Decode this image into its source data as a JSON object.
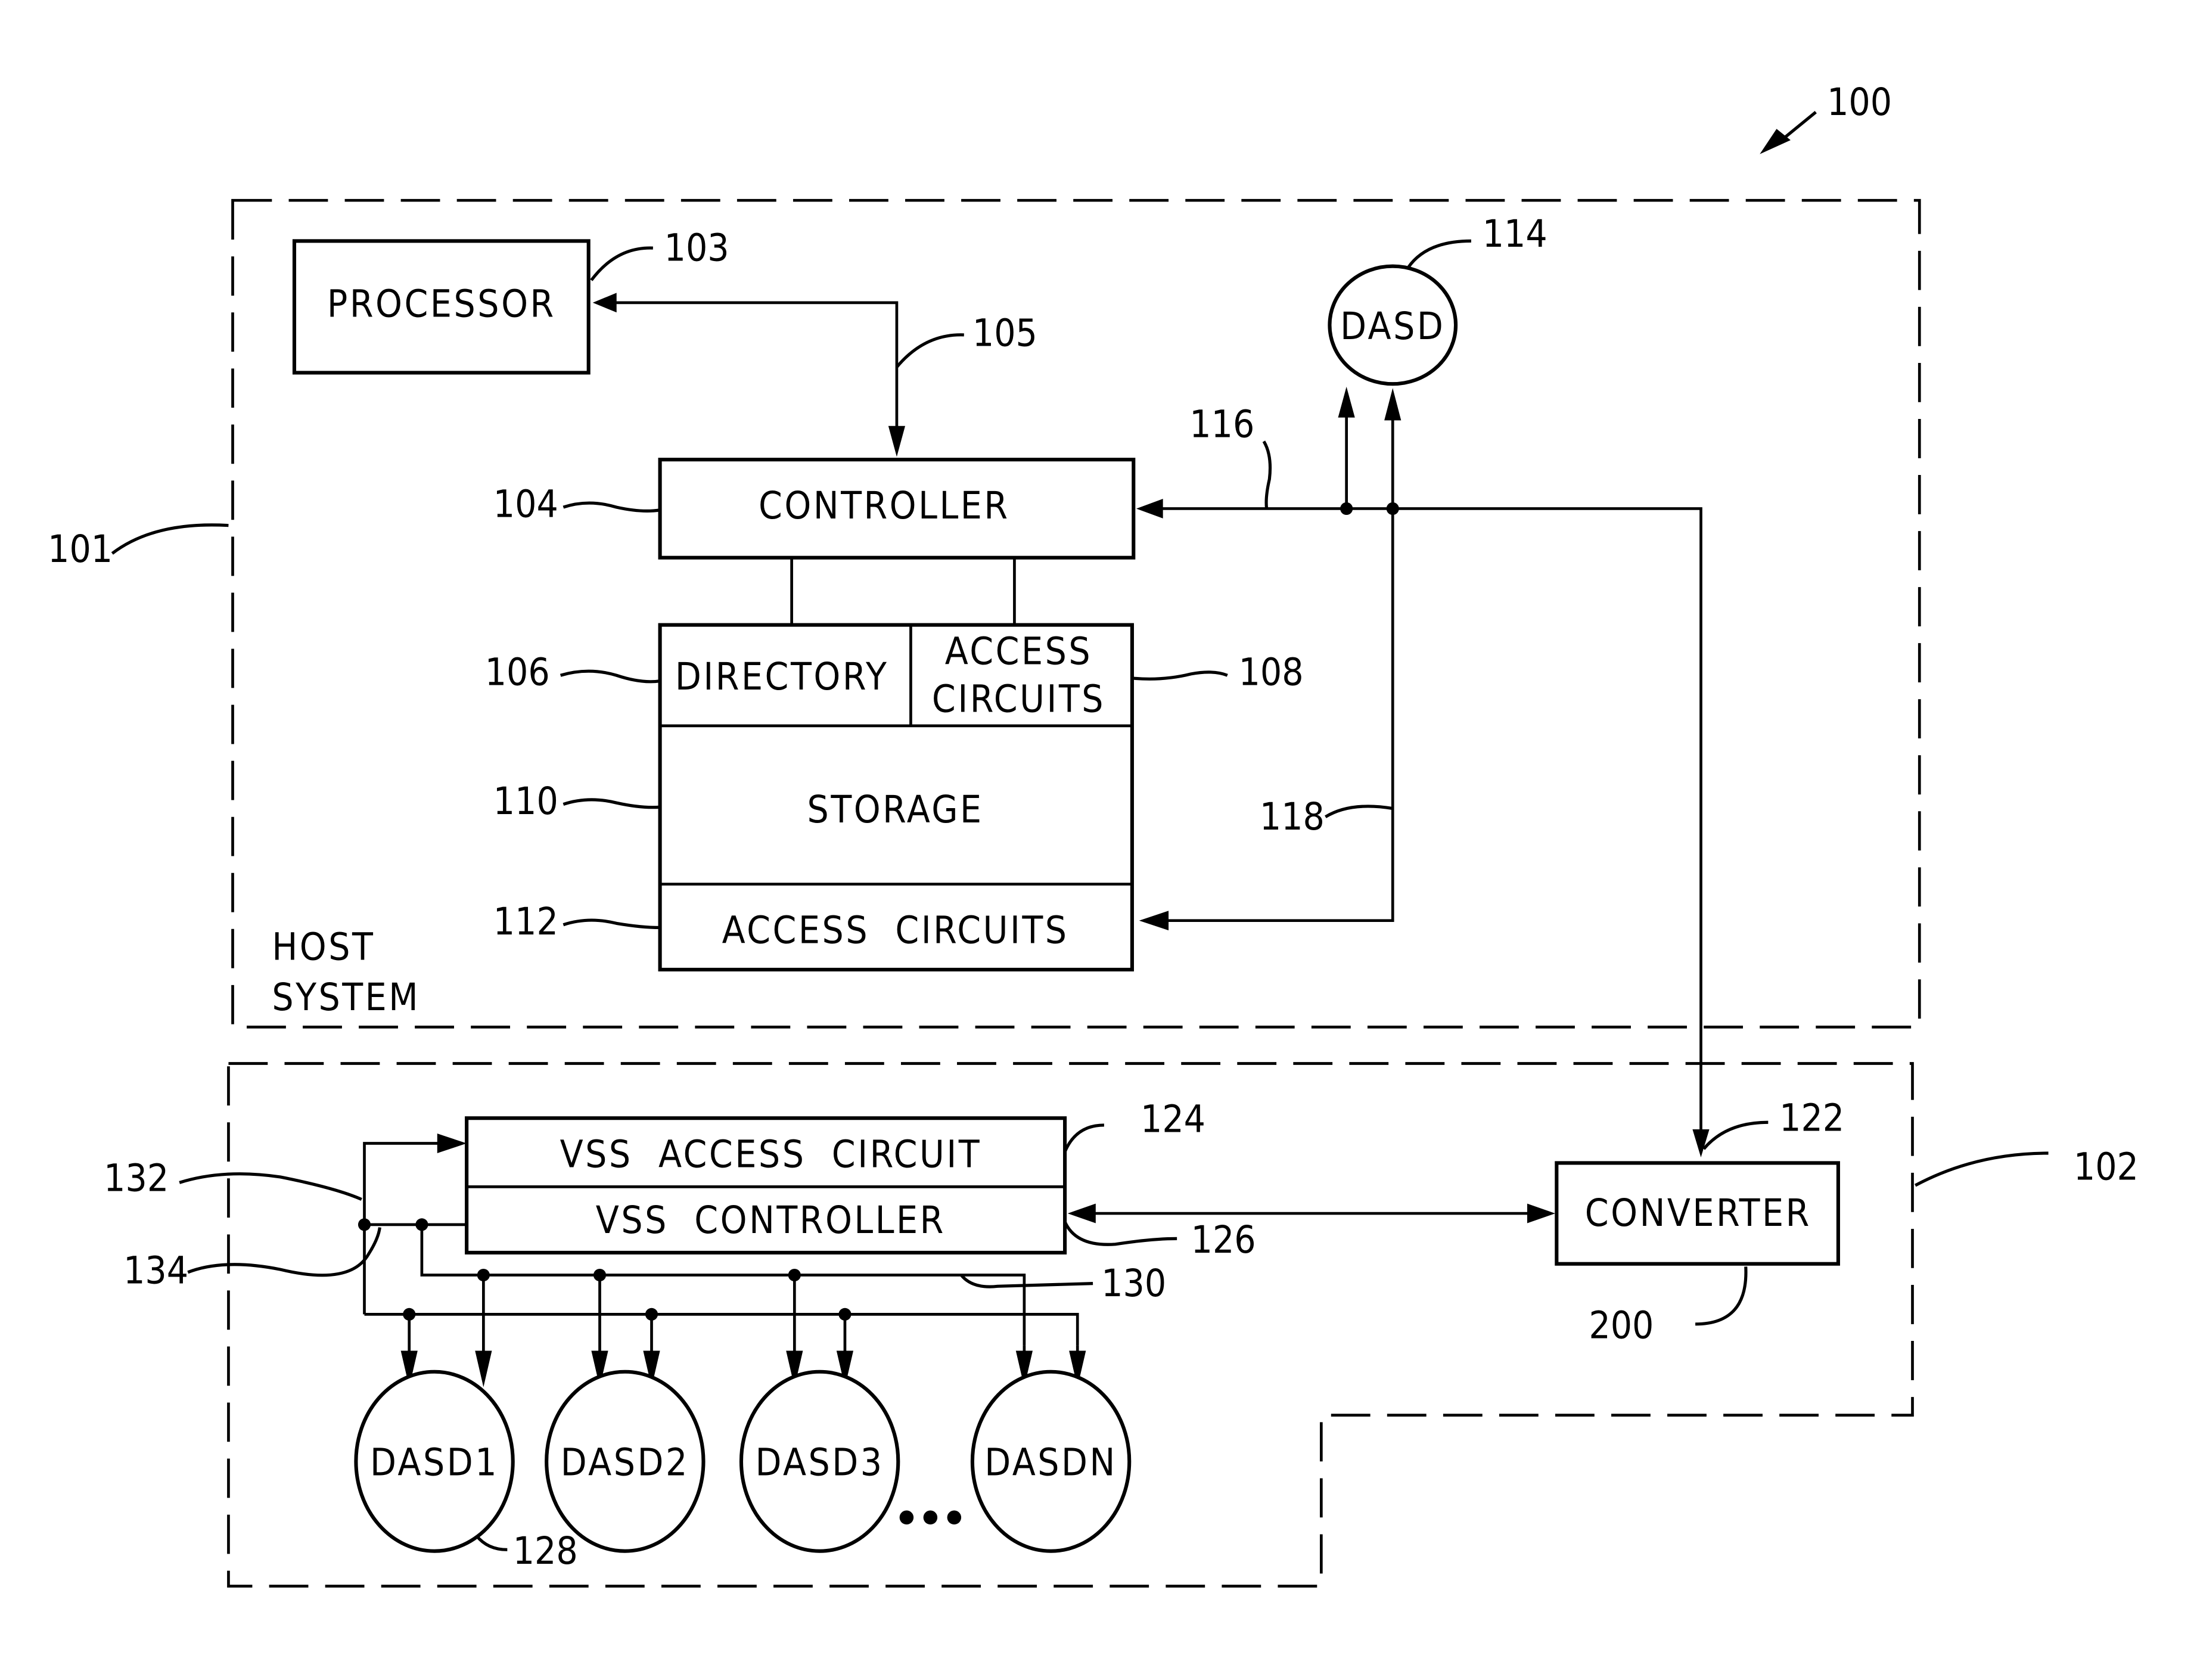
{
  "figure": {
    "ref_number": "100",
    "host_system": {
      "ref": "101",
      "label_line1": "HOST",
      "label_line2": "SYSTEM",
      "processor": {
        "label": "PROCESSOR",
        "ref": "103"
      },
      "bus": {
        "ref": "105"
      },
      "controller": {
        "label": "CONTROLLER",
        "ref": "104"
      },
      "directory": {
        "label": "DIRECTORY",
        "ref": "106"
      },
      "access_circuits_top": {
        "label_line1": "ACCESS",
        "label_line2": "CIRCUITS",
        "ref": "108"
      },
      "storage": {
        "label": "STORAGE",
        "ref": "110"
      },
      "access_circuits_bottom": {
        "label": "ACCESS  CIRCUITS",
        "ref": "112"
      },
      "dasd": {
        "label": "DASD",
        "ref": "114"
      },
      "link_116": {
        "ref": "116"
      },
      "link_118": {
        "ref": "118"
      }
    },
    "subsystem": {
      "ref": "102",
      "converter": {
        "label": "CONVERTER",
        "ref": "200",
        "input_ref": "122"
      },
      "vss_access_circuit": {
        "label": "VSS  ACCESS  CIRCUIT",
        "ref": "124"
      },
      "vss_controller": {
        "label": "VSS  CONTROLLER",
        "ref": "126"
      },
      "bus_130": {
        "ref": "130"
      },
      "bus_132": {
        "ref": "132"
      },
      "bus_134": {
        "ref": "134"
      },
      "dasd_array": [
        {
          "label": "DASD1",
          "ref": "128"
        },
        {
          "label": "DASD2"
        },
        {
          "label": "DASD3"
        },
        {
          "label": "DASDN"
        }
      ],
      "ellipsis": "..."
    }
  }
}
